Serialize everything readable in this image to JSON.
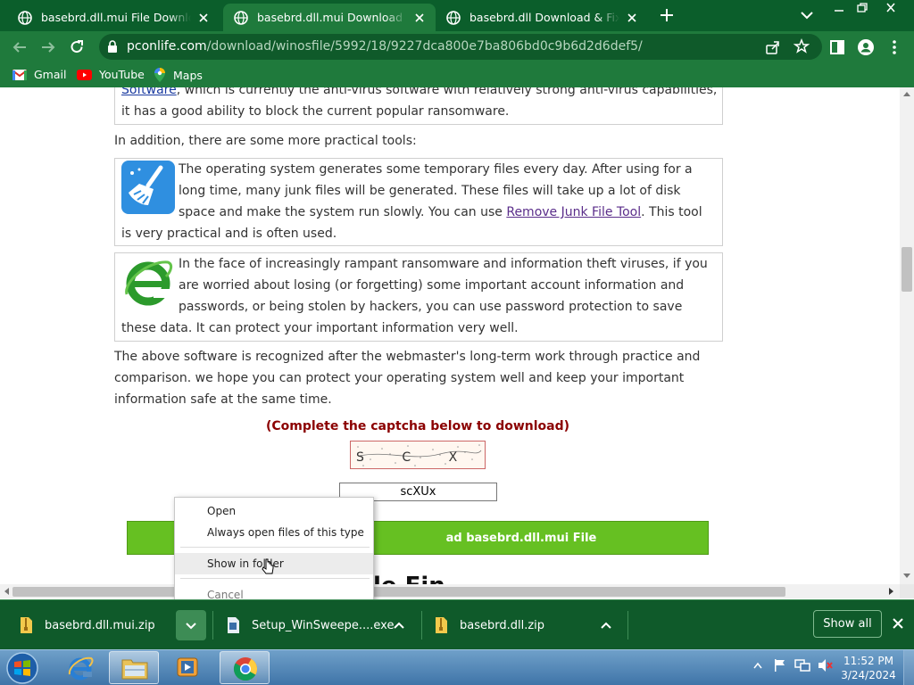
{
  "browser": {
    "tabs": [
      {
        "label": "basebrd.dll.mui File Download & Fix For Windows"
      },
      {
        "label": "basebrd.dll.mui Download & Fix For Windows"
      },
      {
        "label": "basebrd.dll Download & Fix For Windows"
      }
    ],
    "active_tab_index": 1,
    "url_domain": "pconlife.com",
    "url_path": "/download/winosfile/5992/18/9227dca800e7ba806bd0c9b6d2d6def5/",
    "bookmarks": [
      {
        "label": "Gmail",
        "icon": "gmail-icon"
      },
      {
        "label": "YouTube",
        "icon": "youtube-icon"
      },
      {
        "label": "Maps",
        "icon": "maps-icon"
      }
    ],
    "theme_color": "#1f7a3c"
  },
  "page": {
    "top_box": {
      "link_partial": "Software",
      "line1_rest": ", which is currently the anti-virus software with relatively strong anti-virus capabilities,",
      "line2": "it has a good ability to block the current popular ransomware."
    },
    "intro": "In addition, there are some more practical tools:",
    "junk_box": {
      "text_before": "The operating system generates some temporary files every day. After using for a long time, many junk files will be generated. These files will take up a lot of disk space and make the system run slowly. You can use ",
      "link": "Remove Junk File Tool",
      "text_after": ". This tool is very practical and is often used."
    },
    "password_box": {
      "text": "In the face of increasingly rampant ransomware and information theft viruses, if you are worried about losing (or forgetting) some important account information and passwords, or being stolen by hackers, you can use password protection to save these data. It can protect your important information very well."
    },
    "summary": "The above software is recognized after the webmaster's long-term work through practice and comparison. we hope you can protect your operating system well and keep your important information safe at the same time.",
    "captcha_title": "(Complete the captcha below to download)",
    "captcha_chars": "S C X U X",
    "captcha_value": "scXUx",
    "download_button": "ad basebrd.dll.mui File",
    "heading_partial": "le Fin"
  },
  "context_menu": {
    "items": [
      {
        "label": "Open"
      },
      {
        "label": "Always open files of this type"
      },
      {
        "label": "Show in folder"
      },
      {
        "label": "Cancel"
      }
    ]
  },
  "downloads": {
    "items": [
      {
        "name": "basebrd.dll.mui.zip"
      },
      {
        "name": "Setup_WinSweepe....exe"
      },
      {
        "name": "basebrd.dll.zip"
      }
    ],
    "show_all": "Show all"
  },
  "taskbar": {
    "time": "11:52 PM",
    "date": "3/24/2024"
  }
}
